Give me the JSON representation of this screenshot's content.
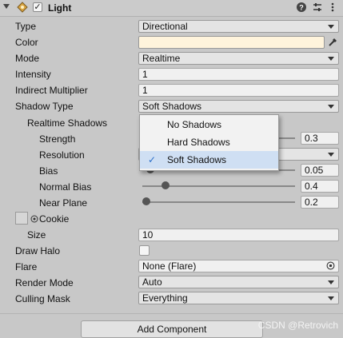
{
  "header": {
    "title": "Light",
    "enabled_mark": "✓",
    "help_icon": "help-icon",
    "preset_icon": "preset-icon",
    "menu_icon": "kebab-menu-icon"
  },
  "fields": {
    "type": {
      "label": "Type",
      "value": "Directional"
    },
    "color": {
      "label": "Color",
      "value_hex": "#fff4dc"
    },
    "mode": {
      "label": "Mode",
      "value": "Realtime"
    },
    "intensity": {
      "label": "Intensity",
      "value": "1"
    },
    "indirect_multiplier": {
      "label": "Indirect Multiplier",
      "value": "1"
    },
    "shadow_type": {
      "label": "Shadow Type",
      "value": "Soft Shadows"
    },
    "realtime_shadows": {
      "label": "Realtime Shadows"
    },
    "strength": {
      "label": "Strength",
      "value": "0.3",
      "fraction": 0.3
    },
    "resolution": {
      "label": "Resolution"
    },
    "bias": {
      "label": "Bias",
      "value": "0.05",
      "fraction": 0.025
    },
    "normal_bias": {
      "label": "Normal Bias",
      "value": "0.4",
      "fraction": 0.13
    },
    "near_plane": {
      "label": "Near Plane",
      "value": "0.2",
      "fraction": 0.0
    },
    "cookie": {
      "label": "Cookie"
    },
    "size": {
      "label": "Size",
      "value": "10"
    },
    "draw_halo": {
      "label": "Draw Halo"
    },
    "flare": {
      "label": "Flare",
      "value": "None (Flare)"
    },
    "render_mode": {
      "label": "Render Mode",
      "value": "Auto"
    },
    "culling_mask": {
      "label": "Culling Mask",
      "value": "Everything"
    }
  },
  "popup": {
    "items": [
      {
        "label": "No Shadows",
        "selected": false
      },
      {
        "label": "Hard Shadows",
        "selected": false
      },
      {
        "label": "Soft Shadows",
        "selected": true
      }
    ],
    "check_mark": "✓"
  },
  "add_component_label": "Add Component",
  "watermark": "CSDN @Retrovich"
}
